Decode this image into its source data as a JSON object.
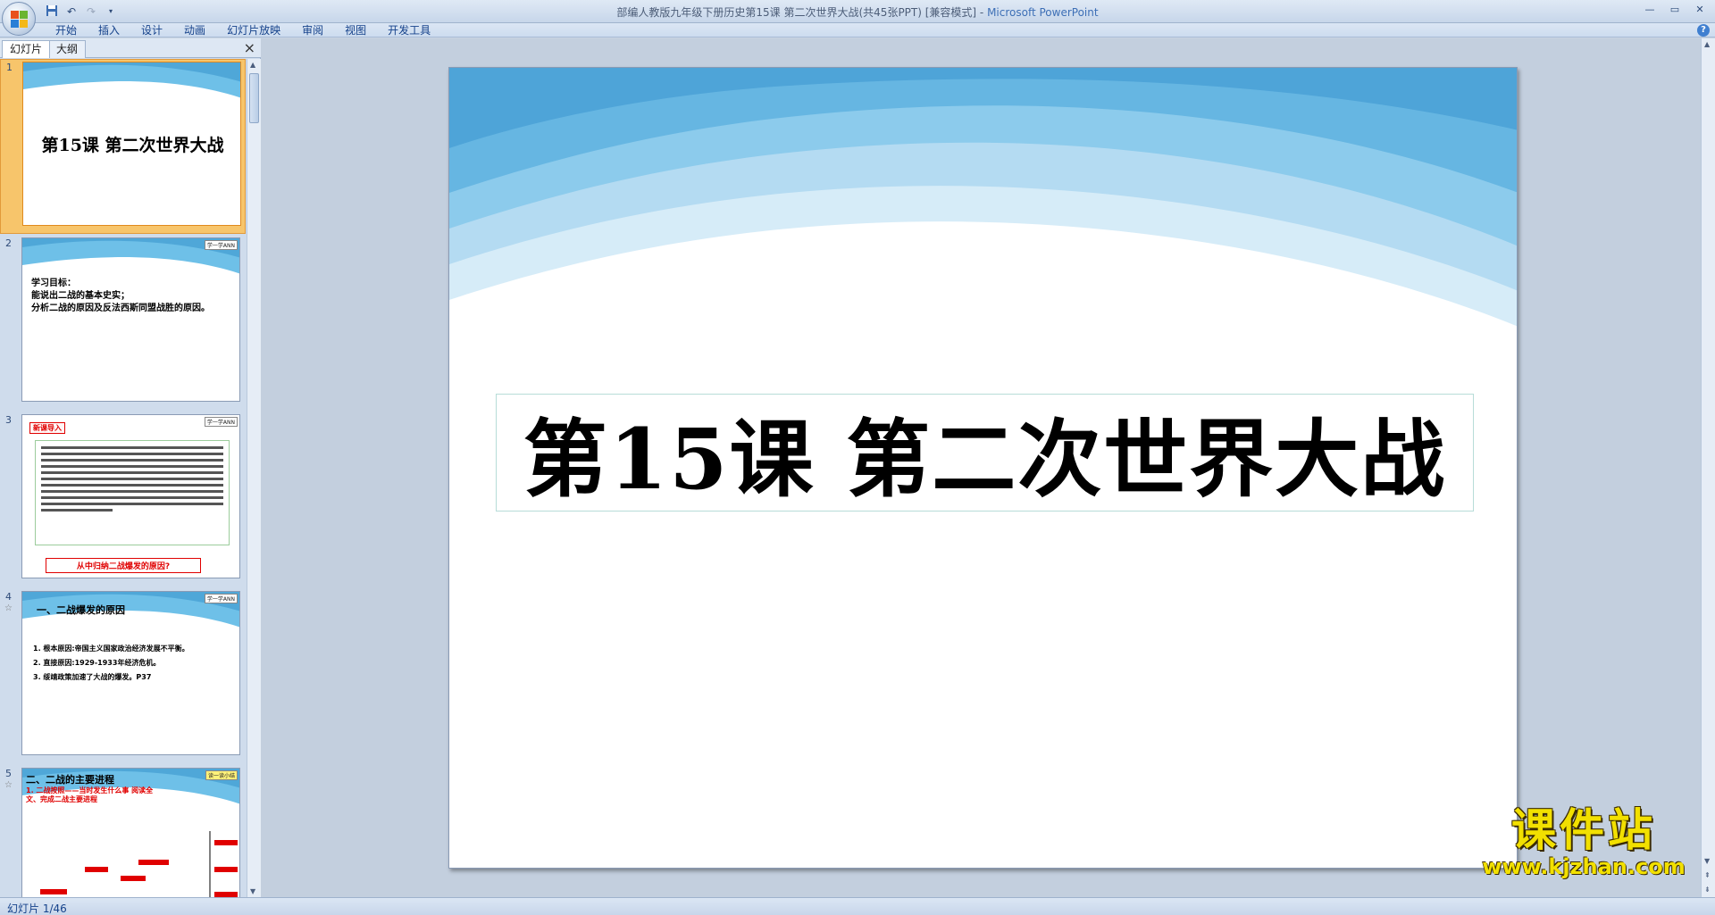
{
  "titlebar": {
    "document": "部编人教版九年级下册历史第15课 第二次世界大战(共45张PPT) [兼容模式]",
    "separator": " - ",
    "app": "Microsoft PowerPoint",
    "qat_icons": [
      "save-icon",
      "undo-icon",
      "redo-icon",
      "customize-icon"
    ],
    "controls": [
      "minimize-icon",
      "maximize-icon",
      "close-icon"
    ]
  },
  "ribbon": {
    "tabs": [
      "开始",
      "插入",
      "设计",
      "动画",
      "幻灯片放映",
      "审阅",
      "视图",
      "开发工具"
    ]
  },
  "left_panel": {
    "tabs": [
      "幻灯片",
      "大纲"
    ],
    "close": "×"
  },
  "thumbnails": [
    {
      "num": "1",
      "title": "第15课 第二次世界大战"
    },
    {
      "num": "2",
      "badge": "学一学ANN",
      "bullets": [
        "学习目标：",
        "能说出二战的基本史实；",
        "分析二战的原因及反法西斯同盟战胜的原因。"
      ]
    },
    {
      "num": "3",
      "badge": "学一学ANN",
      "label": "新课导入",
      "question": "从中归纳二战爆发的原因?"
    },
    {
      "num": "4",
      "star": "☆",
      "badge": "学一学ANN",
      "heading": "一、二战爆发的原因",
      "items": [
        "1. 根本原因:帝国主义国家政治经济发展不平衡。",
        "2. 直接原因:1929-1933年经济危机。",
        "3. 绥靖政策加速了大战的爆发。P37"
      ]
    },
    {
      "num": "5",
      "star": "☆",
      "badge": "读一读小结",
      "heading": "二、二战的主要进程",
      "sub": "1. 二战按照——当时发生什么事 阅读全文、完成二战主要进程"
    }
  ],
  "slide": {
    "title": "第15课  第二次世界大战"
  },
  "watermark": {
    "main": "课件站",
    "url": "www.kjzhan.com"
  },
  "status": {
    "text": "幻灯片 1/46"
  },
  "colors": {
    "ribbon_text": "#15428b",
    "wave_blue": "#5fb4e0",
    "selected_thumb": "#f7c56b"
  }
}
